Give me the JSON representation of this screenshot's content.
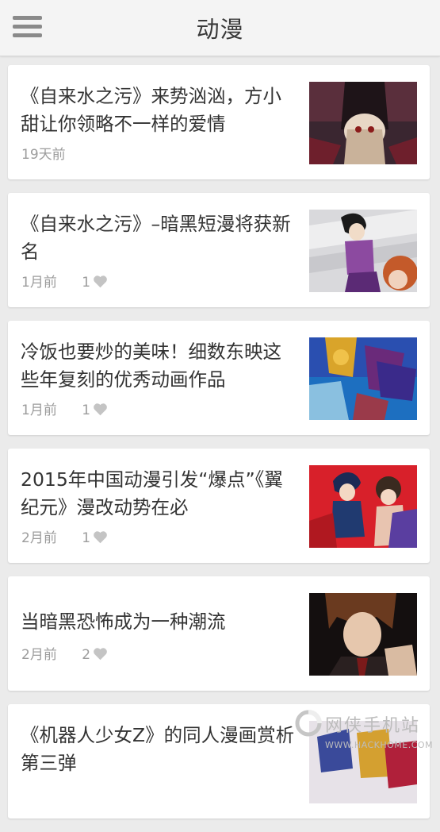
{
  "header": {
    "title": "动漫",
    "menu_icon": "hamburger-menu-icon"
  },
  "articles": [
    {
      "title": "《自来水之污》来势汹汹，方小甜让你领略不一样的爱情",
      "time": "19天前",
      "likes": ""
    },
    {
      "title": "《自来水之污》–暗黑短漫将获新名",
      "time": "1月前",
      "likes": "1"
    },
    {
      "title": "冷饭也要炒的美味！细数东映这些年复刻的优秀动画作品",
      "time": "1月前",
      "likes": "1"
    },
    {
      "title": "2015年中国动漫引发“爆点”《翼纪元》漫改动势在必",
      "time": "2月前",
      "likes": "1"
    },
    {
      "title": "当暗黑恐怖成为一种潮流",
      "time": "2月前",
      "likes": "2"
    },
    {
      "title": "《机器人少女Z》的同人漫画赏析第三弹",
      "time": "",
      "likes": ""
    }
  ],
  "watermark": {
    "text": "网侠手机站",
    "url": "WWW.HACKHOME.COM"
  },
  "colors": {
    "background": "#ebebeb",
    "header": "#f4f4f4",
    "text": "#333333",
    "meta": "#9c9c9c"
  }
}
